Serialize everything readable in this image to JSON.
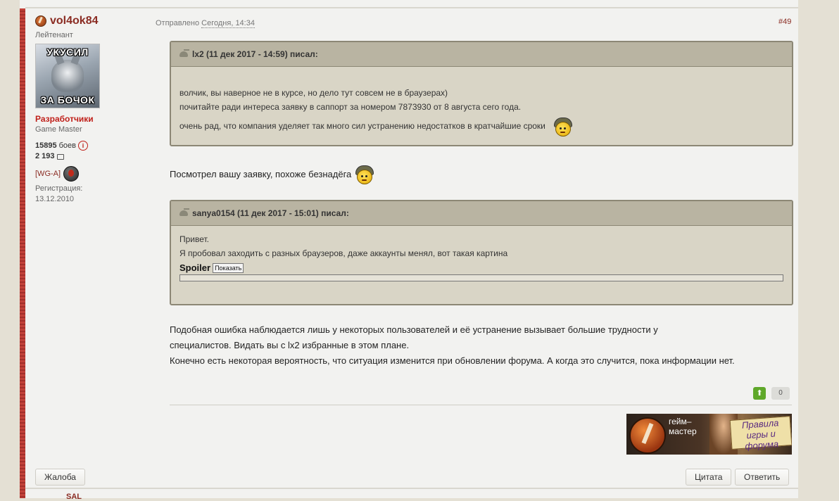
{
  "author": {
    "name": "vol4ok84",
    "rank": "Лейтенант",
    "avatar_top_text": "УКУСИЛ",
    "avatar_bottom_text": "ЗА БОЧОК",
    "group": "Разработчики",
    "group_sub": "Game Master",
    "battles_value": "15895",
    "battles_label": "боев",
    "posts_value": "2 193",
    "clan": "[WG-A]",
    "reg_label": "Регистрация:",
    "reg_date": "13.12.2010"
  },
  "post": {
    "posted_prefix": "Отправлено",
    "posted_when": "Сегодня, 14:34",
    "number": "#49",
    "quote1": {
      "header": "lx2 (11 дек 2017 - 14:59) писал:",
      "line1": "волчик, вы наверное не в курсе, но дело тут совсем не в браузерах)",
      "line2": "почитайте ради интереса заявку в саппорт за номером 7873930 от 8 августа сего года.",
      "line3": "очень рад, что компания уделяет так много сил устранению недостатков в кратчайшие сроки"
    },
    "reply": "Посмотрел вашу заявку, похоже безнадёга",
    "quote2": {
      "header": "sanya0154 (11 дек 2017 - 15:01) писал:",
      "line1": "Привет.",
      "line2": "Я пробовал заходить с разных браузеров, даже аккаунты менял, вот такая картина",
      "spoiler_label": "Spoiler",
      "spoiler_button": "Показать"
    },
    "body": [
      "Подобная ошибка наблюдается лишь у некоторых пользователей и её устранение вызывает большие трудности у",
      "специалистов. Видать вы с lx2 избранные в этом плане.",
      "Конечно есть некоторая вероятность, что ситуация изменится при обновлении форума. А когда это случится, пока информации нет."
    ],
    "rating_count": "0",
    "vote_up_symbol": "⬆"
  },
  "signature": {
    "gm_line1": "гейм–",
    "gm_line2": "мастер",
    "rules_line1": "Правила",
    "rules_line2": "игры и форума"
  },
  "actions": {
    "complaint": "Жалоба",
    "quote": "Цитата",
    "reply": "Ответить"
  },
  "next_post_peek": "SAL",
  "icons": {
    "author_badge": "wg-logo-icon",
    "info": "info-icon",
    "posts": "comment-icon",
    "clan_badge": "clan-emblem-icon",
    "quote": "quote-tank-icon",
    "smiley": "tanker-smiley-icon"
  },
  "colors": {
    "author_name": "#8a2b22",
    "group": "#c0201a",
    "quote_bg": "#d9d5c6",
    "quote_header_bg": "#b9b4a2",
    "vote_up": "#5fa82a"
  }
}
